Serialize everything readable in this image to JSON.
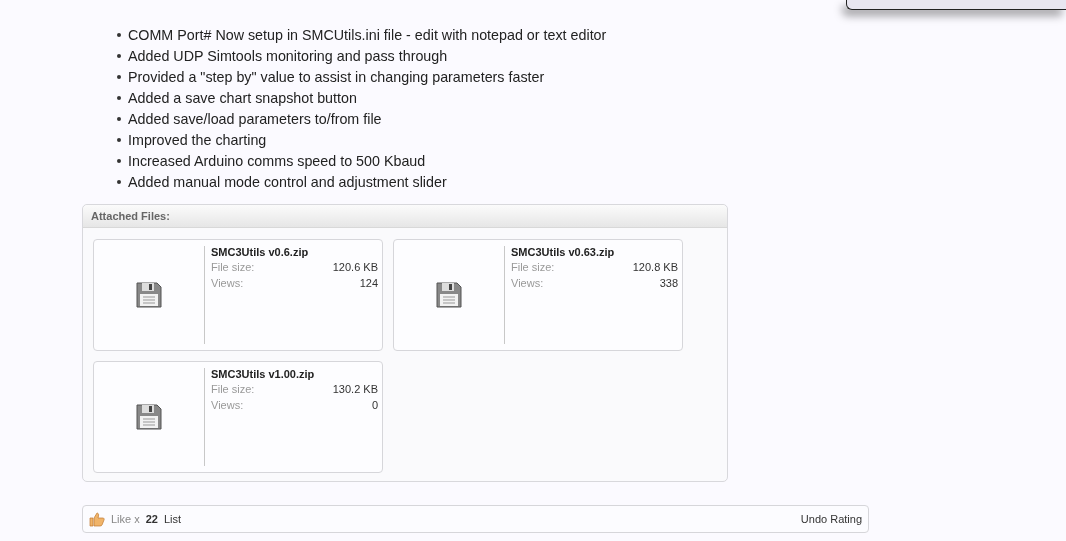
{
  "changes": [
    "COMM Port# Now setup in SMCUtils.ini file - edit with notepad or text editor",
    "Added UDP Simtools monitoring and pass through",
    "Provided a \"step by\" value to assist in changing parameters faster",
    "Added a save chart snapshot button",
    "Added save/load parameters to/from file",
    "Improved the charting",
    "Increased Arduino comms speed to 500 Kbaud",
    "Added manual mode control and adjustment slider"
  ],
  "attachments": {
    "title": "Attached Files:",
    "files": [
      {
        "name": "SMC3Utils v0.6.zip",
        "size_label": "File size:",
        "size": "120.6 KB",
        "views_label": "Views:",
        "views": "124"
      },
      {
        "name": "SMC3Utils v0.63.zip",
        "size_label": "File size:",
        "size": "120.8 KB",
        "views_label": "Views:",
        "views": "338"
      },
      {
        "name": "SMC3Utils v1.00.zip",
        "size_label": "File size:",
        "size": "130.2 KB",
        "views_label": "Views:",
        "views": "0"
      }
    ]
  },
  "likes": {
    "label": "Like x",
    "count": "22",
    "list_link": "List",
    "undo": "Undo Rating"
  }
}
